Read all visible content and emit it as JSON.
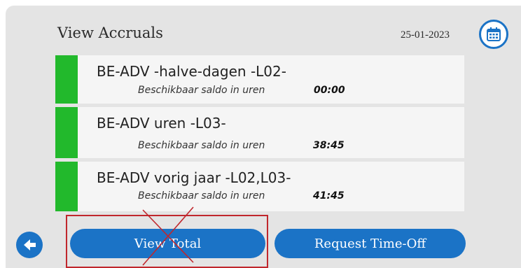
{
  "header": {
    "title": "View Accruals",
    "date": "25-01-2023"
  },
  "accruals": [
    {
      "name": "BE-ADV -halve-dagen  -L02-",
      "saldo_label": "Beschikbaar saldo in uren",
      "saldo_value": "00:00"
    },
    {
      "name": "BE-ADV uren -L03-",
      "saldo_label": "Beschikbaar saldo in uren",
      "saldo_value": "38:45"
    },
    {
      "name": "BE-ADV vorig jaar -L02,L03-",
      "saldo_label": "Beschikbaar saldo in uren",
      "saldo_value": "41:45"
    }
  ],
  "footer": {
    "view_total_label": "View Total",
    "request_timeoff_label": "Request Time-Off"
  },
  "icons": {
    "calendar": "calendar-icon",
    "back": "back-arrow-icon"
  },
  "colors": {
    "accent": "#1b73c6",
    "status_green": "#22b92c",
    "annotation_red": "#c0272d"
  }
}
